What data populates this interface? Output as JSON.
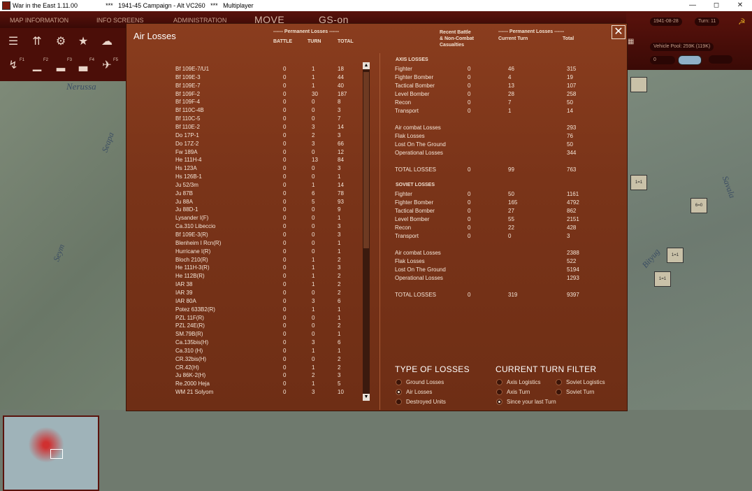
{
  "window": {
    "app_title": "War in the East 1.11.00",
    "scenario": "***   1941-45 Campaign - Alt VC260   ***   Multiplayer",
    "min_label": "—",
    "max_label": "◻",
    "close_label": "✕"
  },
  "topbar": {
    "map_information": "MAP INFORMATION",
    "info_screens": "INFO SCREENS",
    "administration": "ADMINISTRATION",
    "move": "MOVE",
    "gs_on": "GS-on"
  },
  "status": {
    "date": "1941-08-28",
    "turn": "Turn: 11",
    "vehicle_pool": "Vehicle Pool: 259K (119K)",
    "value_field": "0"
  },
  "function_keys": [
    "F1",
    "F2",
    "F3",
    "F4",
    "F5"
  ],
  "map": {
    "river_labels": [
      "Nerussa",
      "Seapa",
      "Seym",
      "Bityug",
      "Savala"
    ],
    "unit_labels": [
      "1=1",
      "6=0",
      "1=1",
      "1=1"
    ]
  },
  "dialog": {
    "title": "Air Losses",
    "close": "✕",
    "left_header": {
      "group": "------ Permanent Losses ------",
      "battle": "BATTLE",
      "turn": "TURN",
      "total": "TOTAL"
    },
    "right_header": {
      "recent": "Recent Battle\n& Non-Combat\nCasualties",
      "group": "------ Permanent Losses ------",
      "current_turn": "Current Turn",
      "total": "Total"
    },
    "aircraft": [
      [
        "Bf 109E-7/U1",
        "0",
        "1",
        "18"
      ],
      [
        "Bf 109E-3",
        "0",
        "1",
        "44"
      ],
      [
        "Bf 109E-7",
        "0",
        "1",
        "40"
      ],
      [
        "Bf 109F-2",
        "0",
        "30",
        "187"
      ],
      [
        "Bf 109F-4",
        "0",
        "0",
        "8"
      ],
      [
        "Bf 110C-4B",
        "0",
        "0",
        "3"
      ],
      [
        "Bf 110C-5",
        "0",
        "0",
        "7"
      ],
      [
        "Bf 110E-2",
        "0",
        "3",
        "14"
      ],
      [
        "Do 17P-1",
        "0",
        "2",
        "3"
      ],
      [
        "Do 17Z-2",
        "0",
        "3",
        "66"
      ],
      [
        "Fw 189A",
        "0",
        "0",
        "12"
      ],
      [
        "He 111H-4",
        "0",
        "13",
        "84"
      ],
      [
        "Hs 123A",
        "0",
        "0",
        "3"
      ],
      [
        "Hs 126B-1",
        "0",
        "0",
        "1"
      ],
      [
        "Ju 52/3m",
        "0",
        "1",
        "14"
      ],
      [
        "Ju 87B",
        "0",
        "6",
        "78"
      ],
      [
        "Ju 88A",
        "0",
        "5",
        "93"
      ],
      [
        "Ju 88D-1",
        "0",
        "0",
        "9"
      ],
      [
        "Lysander I(F)",
        "0",
        "0",
        "1"
      ],
      [
        "Ca.310 Libeccio",
        "0",
        "0",
        "3"
      ],
      [
        "Bf 109E-3(R)",
        "0",
        "0",
        "3"
      ],
      [
        "Blenheim I Rcn(R)",
        "0",
        "0",
        "1"
      ],
      [
        "Hurricane I(R)",
        "0",
        "0",
        "1"
      ],
      [
        "Bloch 210(R)",
        "0",
        "1",
        "2"
      ],
      [
        "He 111H-3(R)",
        "0",
        "1",
        "3"
      ],
      [
        "He 112B(R)",
        "0",
        "1",
        "2"
      ],
      [
        "IAR 38",
        "0",
        "1",
        "2"
      ],
      [
        "IAR 39",
        "0",
        "0",
        "2"
      ],
      [
        "IAR 80A",
        "0",
        "3",
        "6"
      ],
      [
        "Potez 633B2(R)",
        "0",
        "1",
        "1"
      ],
      [
        "PZL 11F(R)",
        "0",
        "0",
        "1"
      ],
      [
        "PZL 24E(R)",
        "0",
        "0",
        "2"
      ],
      [
        "SM.79B(R)",
        "0",
        "0",
        "1"
      ],
      [
        "Ca.135bis(H)",
        "0",
        "3",
        "6"
      ],
      [
        "Ca.310 (H)",
        "0",
        "1",
        "1"
      ],
      [
        "CR.32bis(H)",
        "0",
        "0",
        "2"
      ],
      [
        "CR.42(H)",
        "0",
        "1",
        "2"
      ],
      [
        "Ju 86K-2(H)",
        "0",
        "2",
        "3"
      ],
      [
        "Re.2000 Heja",
        "0",
        "1",
        "5"
      ],
      [
        "WM 21 Solyom",
        "0",
        "3",
        "10"
      ]
    ],
    "axis": {
      "title": "AXIS LOSSES",
      "rows": [
        [
          "Fighter",
          "0",
          "46",
          "315"
        ],
        [
          "Fighter Bomber",
          "0",
          "4",
          "19"
        ],
        [
          "Tactical Bomber",
          "0",
          "13",
          "107"
        ],
        [
          "Level Bomber",
          "0",
          "28",
          "258"
        ],
        [
          "Recon",
          "0",
          "7",
          "50"
        ],
        [
          "Transport",
          "0",
          "1",
          "14"
        ]
      ],
      "causes": [
        [
          "Air combat Losses",
          "293"
        ],
        [
          "Flak Losses",
          "76"
        ],
        [
          "Lost On The Ground",
          "50"
        ],
        [
          "Operational Losses",
          "344"
        ]
      ],
      "total": [
        "TOTAL LOSSES",
        "0",
        "99",
        "763"
      ]
    },
    "soviet": {
      "title": "SOVIET LOSSES",
      "rows": [
        [
          "Fighter",
          "0",
          "50",
          "1161"
        ],
        [
          "Fighter Bomber",
          "0",
          "165",
          "4792"
        ],
        [
          "Tactical Bomber",
          "0",
          "27",
          "862"
        ],
        [
          "Level Bomber",
          "0",
          "55",
          "2151"
        ],
        [
          "Recon",
          "0",
          "22",
          "428"
        ],
        [
          "Transport",
          "0",
          "0",
          "3"
        ]
      ],
      "causes": [
        [
          "Air combat Losses",
          "2388"
        ],
        [
          "Flak Losses",
          "522"
        ],
        [
          "Lost On The Ground",
          "5194"
        ],
        [
          "Operational Losses",
          "1293"
        ]
      ],
      "total": [
        "TOTAL LOSSES",
        "0",
        "319",
        "9397"
      ]
    },
    "type_of_losses": {
      "title": "TYPE OF LOSSES",
      "options": [
        "Ground Losses",
        "Air Losses",
        "Destroyed Units"
      ],
      "selected": "Air Losses"
    },
    "turn_filter": {
      "title": "CURRENT TURN FILTER",
      "options": [
        "Axis Logistics",
        "Soviet Logistics",
        "Axis Turn",
        "Soviet Turn",
        "Since your last Turn"
      ],
      "selected": "Since your last Turn"
    }
  }
}
